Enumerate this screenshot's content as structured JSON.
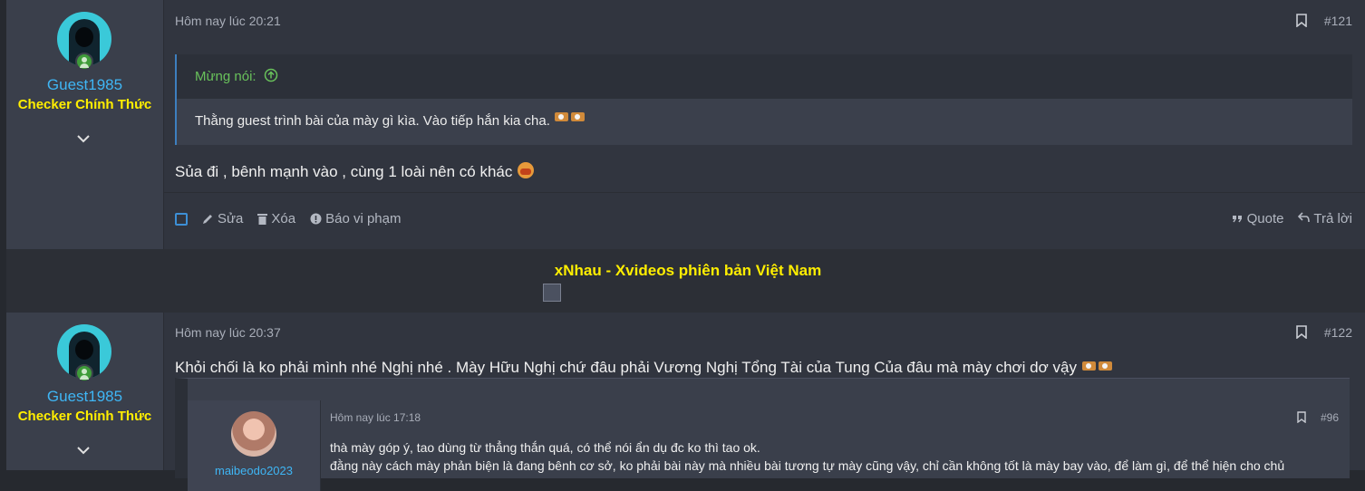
{
  "posts": [
    {
      "user": {
        "name": "Guest1985",
        "title": "Checker Chính Thức"
      },
      "timestamp": "Hôm nay lúc 20:21",
      "number": "#121",
      "quote": {
        "author": "Mừng nói:",
        "text": "Thằng guest trình bài của mày gì kìa. Vào tiếp hắn kia cha."
      },
      "message": "Sủa đi , bênh mạnh vào , cùng 1 loài nên có khác",
      "actions": {
        "edit": "Sửa",
        "delete": "Xóa",
        "report": "Báo vi phạm",
        "quote": "Quote",
        "reply": "Trả lời"
      }
    },
    {
      "user": {
        "name": "Guest1985",
        "title": "Checker Chính Thức"
      },
      "timestamp": "Hôm nay lúc 20:37",
      "number": "#122",
      "message": "Khỏi chối là ko phải mình nhé Nghị nhé . Mày Hữu Nghị chứ đâu phải Vương Nghị Tổng Tài của Tung Của đâu mà mày chơi dơ vậy",
      "embedded": {
        "timestamp": "Hôm nay lúc 17:18",
        "number": "#96",
        "username": "maibeodo2023",
        "line1": "thà mày góp ý, tao dùng từ thẳng thắn quá, có thể nói ẩn dụ đc ko thì tao ok.",
        "line2": "đằng này cách mày phản biện là đang bênh cơ sở, ko phải bài này mà nhiều bài tương tự mày cũng vậy, chỉ cần không tốt là mày bay vào, để làm gì, để thể hiện cho chủ"
      }
    }
  ],
  "ad": {
    "text": "xNhau - Xvideos phiên bản Việt Nam"
  },
  "colors": {
    "accent": "#3fb6f5",
    "title": "#ffee00",
    "quote_author": "#69c25b"
  }
}
